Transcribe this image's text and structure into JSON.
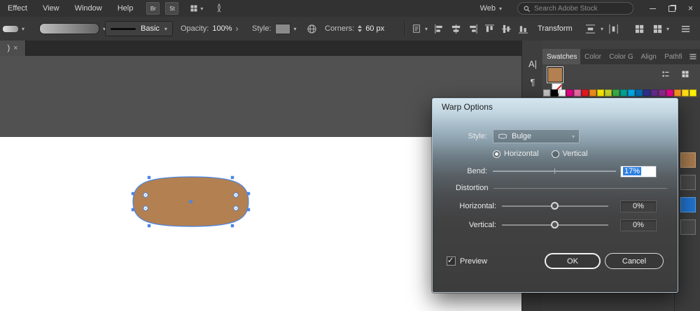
{
  "menubar": {
    "items": [
      {
        "label": "Effect"
      },
      {
        "label": "View"
      },
      {
        "label": "Window"
      },
      {
        "label": "Help"
      }
    ],
    "bridge_badge": "Br",
    "stock_badge": "St",
    "workspace_label": "Web",
    "search_placeholder": "Search Adobe Stock"
  },
  "controlbar": {
    "brush_name": "Basic",
    "opacity_label": "Opacity:",
    "opacity_value": "100%",
    "style_label": "Style:",
    "corners_label": "Corners:",
    "corners_value": "60 px",
    "transform_label": "Transform"
  },
  "document": {
    "tab_title": ")"
  },
  "tools": {
    "character": "A|",
    "paragraph": "¶",
    "extra": "○"
  },
  "panels": {
    "tabs": [
      {
        "label": "Swatches"
      },
      {
        "label": "Color"
      },
      {
        "label": "Color G"
      },
      {
        "label": "Align"
      },
      {
        "label": "Pathfi"
      }
    ],
    "swatches": {
      "selected_fill": "#b28051",
      "palette": [
        "#c8c8c8",
        "#000000",
        "#ffffff",
        "#ec008c",
        "#f06eaa",
        "#ed1c24",
        "#f7941d",
        "#fff200",
        "#cbdb2a",
        "#39b54a",
        "#00a99d",
        "#00aeef",
        "#0072bc",
        "#2e3192",
        "#662d91",
        "#92278f",
        "#ec008c",
        "#f7941d",
        "#ffde17",
        "#fff200"
      ]
    }
  },
  "canvas": {
    "shape_fill": "#b28051",
    "selection_color": "#4a86e8"
  },
  "dialog": {
    "title": "Warp Options",
    "style_label": "Style:",
    "style_value": "Bulge",
    "radio_horizontal": "Horizontal",
    "radio_vertical": "Vertical",
    "bend_label": "Bend:",
    "bend_value": "17%",
    "distortion_label": "Distortion",
    "horizontal_label": "Horizontal:",
    "horizontal_value": "0%",
    "vertical_label": "Vertical:",
    "vertical_value": "0%",
    "preview_label": "Preview",
    "ok_label": "OK",
    "cancel_label": "Cancel"
  }
}
